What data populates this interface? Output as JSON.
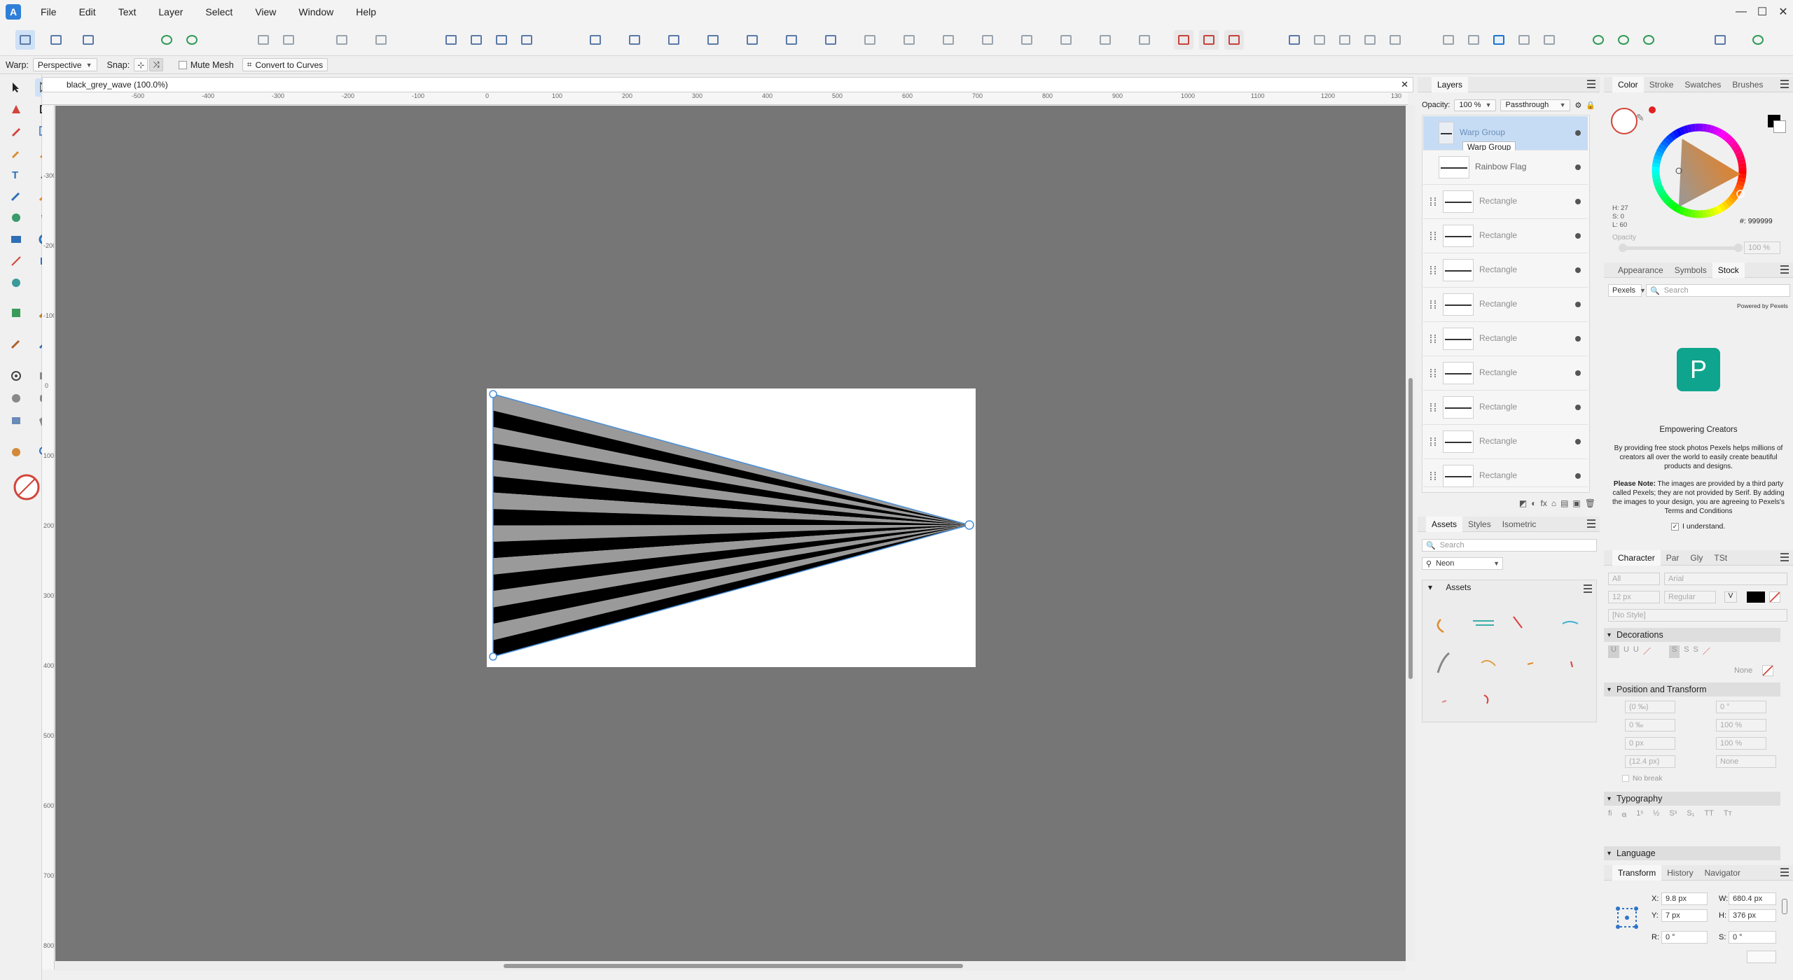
{
  "menu": [
    "File",
    "Edit",
    "Text",
    "Layer",
    "Select",
    "View",
    "Window",
    "Help"
  ],
  "app_logo": "A",
  "window_controls": {
    "minimize": "—",
    "maximize": "☐",
    "close": "✕"
  },
  "context_toolbar": {
    "warp_label": "Warp:",
    "warp_value": "Perspective",
    "snap_label": "Snap:",
    "mute_mesh": "Mute Mesh",
    "convert": "Convert to Curves"
  },
  "document": {
    "tab_title": "black_grey_wave (100.0%)",
    "close": "✕"
  },
  "ruler_h_ticks": [
    "-500",
    "-400",
    "-300",
    "-200",
    "-100",
    "0",
    "100",
    "200",
    "300",
    "400",
    "500",
    "600",
    "700",
    "800",
    "900",
    "1000",
    "1100",
    "1200",
    "130"
  ],
  "ruler_v_ticks": [
    "-300",
    "-200",
    "-100",
    "0",
    "100",
    "200",
    "300",
    "400",
    "500",
    "600",
    "700",
    "800"
  ],
  "layers_panel": {
    "tab": "Layers",
    "opacity_label": "Opacity:",
    "opacity_value": "100 %",
    "blend_mode": "Passthrough",
    "rows": [
      {
        "name": "Warp Group",
        "selected": true
      },
      {
        "name": "Rainbow Flag"
      },
      {
        "name": "Rectangle"
      },
      {
        "name": "Rectangle"
      },
      {
        "name": "Rectangle"
      },
      {
        "name": "Rectangle"
      },
      {
        "name": "Rectangle"
      },
      {
        "name": "Rectangle"
      },
      {
        "name": "Rectangle"
      },
      {
        "name": "Rectangle"
      },
      {
        "name": "Rectangle"
      }
    ],
    "tooltip": "Warp Group"
  },
  "color_panel": {
    "tabs": [
      "Color",
      "Stroke",
      "Swatches",
      "Brushes"
    ],
    "h": "H: 27",
    "s": "S: 0",
    "l": "L: 60",
    "hex": "999999",
    "hex_prefix": "#:",
    "opacity_label": "Opacity",
    "opacity_value": "100 %",
    "accent": "#e0822c"
  },
  "stock_panel": {
    "tabs": [
      "Appearance",
      "Symbols",
      "Stock"
    ],
    "source": "Pexels",
    "search_placeholder": "Search",
    "powered_by": "Powered by Pexels",
    "logo_letter": "P",
    "tagline": "Empowering Creators",
    "desc": "By providing free stock photos Pexels helps millions of creators all over the world to easily create beautiful products and designs.",
    "note_bold": "Please Note:",
    "note": " The images are provided by a third party called Pexels; they are not provided by Serif. By adding the images to your design, you are agreeing to Pexels's Terms and Conditions",
    "understand": "I understand."
  },
  "assets_panel": {
    "tabs": [
      "Assets",
      "Styles",
      "Isometric"
    ],
    "search_placeholder": "Search",
    "category": "Neon",
    "section": "Assets"
  },
  "character_panel": {
    "tabs": [
      "Character",
      "Par",
      "Gly",
      "TSt"
    ],
    "font_collection": "All",
    "font": "Arial",
    "size": "12 px",
    "weight": "Regular",
    "style": "[No Style]",
    "decorations": "Decorations",
    "none": "None",
    "position_transform": "Position and Transform",
    "kern": "(0 ‰)",
    "track": "0 ‰",
    "baseline": "0 px",
    "leading": "(12.4 px)",
    "shear": "0 °",
    "scale_h": "100 %",
    "scale_v": "100 %",
    "none2": "None",
    "no_break": "No break",
    "typography": "Typography",
    "language": "Language"
  },
  "transform_panel": {
    "tabs": [
      "Transform",
      "History",
      "Navigator"
    ],
    "x_label": "X:",
    "x": "9.8 px",
    "y_label": "Y:",
    "y": "7 px",
    "w_label": "W:",
    "w": "680.4 px",
    "h_label": "H:",
    "h": "376 px",
    "r_label": "R:",
    "r": "0 °",
    "s_label": "S:",
    "s": "0 °"
  }
}
